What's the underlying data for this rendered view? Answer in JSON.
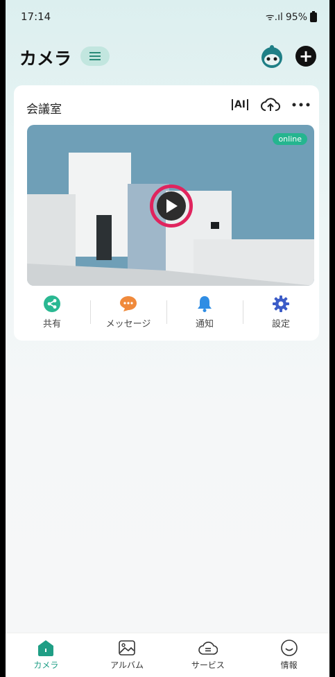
{
  "status_bar": {
    "time": "17:14",
    "signal": "ᯤ.ıl",
    "battery": "95%"
  },
  "header": {
    "title": "カメラ"
  },
  "camera": {
    "name": "会議室",
    "ai_label": "AI",
    "status": "online",
    "actions": [
      {
        "label": "共有",
        "icon": "share-icon",
        "color": "#2ab892"
      },
      {
        "label": "メッセージ",
        "icon": "message-icon",
        "color": "#f08a3c"
      },
      {
        "label": "通知",
        "icon": "bell-icon",
        "color": "#2f8de4"
      },
      {
        "label": "設定",
        "icon": "gear-icon",
        "color": "#3c5cc7"
      }
    ]
  },
  "bottom_nav": [
    {
      "label": "カメラ",
      "icon": "camera-home-icon",
      "active": true
    },
    {
      "label": "アルバム",
      "icon": "album-icon",
      "active": false
    },
    {
      "label": "サービス",
      "icon": "service-icon",
      "active": false
    },
    {
      "label": "情報",
      "icon": "info-smile-icon",
      "active": false
    }
  ],
  "colors": {
    "accent": "#1f9e85",
    "play_ring": "#e0245e"
  }
}
